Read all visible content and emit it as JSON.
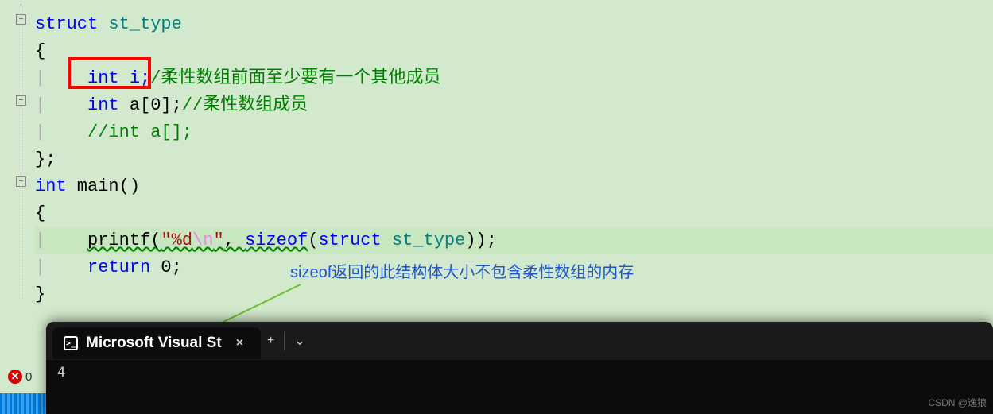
{
  "code": {
    "line1_kw": "struct",
    "line1_type": " st_type",
    "line2": "{",
    "line3_decl": " int i;",
    "line3_comment": "/柔性数组前面至少要有一个其他成员",
    "line4_kw": "int",
    "line4_rest": " a[0];",
    "line4_comment": "//柔性数组成员",
    "line5_comment": "//int a[];",
    "line6": "};",
    "line7_kw": "int",
    "line7_fn": " main()",
    "line8": "{",
    "line9_fn": "printf(",
    "line9_strA": "\"%d",
    "line9_esc": "\\n",
    "line9_strB": "\"",
    "line9_mid": ", ",
    "line9_sizeof": "sizeof",
    "line9_paren1": "(",
    "line9_struct": "struct",
    "line9_type": " st_type",
    "line9_paren2": "));",
    "line10_kw": "return",
    "line10_rest": " 0;",
    "line11": "}"
  },
  "annotation": {
    "text": "sizeof返回的此结构体大小不包含柔性数组的内存"
  },
  "terminal": {
    "tab_title": "Microsoft Visual St",
    "output": "4"
  },
  "status": {
    "error_count": "0"
  },
  "watermark": "CSDN @逸狼",
  "icons": {
    "collapse": "−",
    "tab_icon_glyph": ">_",
    "close": "×",
    "plus": "+",
    "dropdown": "⌄"
  }
}
